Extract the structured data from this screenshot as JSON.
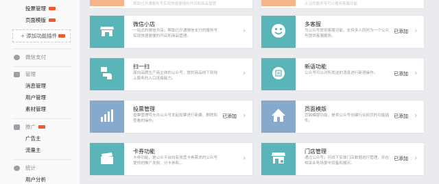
{
  "sidebar": {
    "top_items": [
      {
        "label": "投票管理",
        "badge": true
      },
      {
        "label": "页面模版",
        "badge": true
      }
    ],
    "add_plugin": {
      "icon": "plus-icon",
      "label": "添加功能插件",
      "badge": true
    },
    "groups": [
      {
        "icon": "wechat-pay-icon",
        "label": "微信支付",
        "items": []
      },
      {
        "icon": "manage-icon",
        "label": "管理",
        "items": [
          "消息管理",
          "用户管理",
          "素材管理"
        ]
      },
      {
        "icon": "promote-icon",
        "label": "推广",
        "badge": true,
        "items": [
          "广告主",
          "流量主"
        ]
      },
      {
        "icon": "stats-icon",
        "label": "统计",
        "items": [
          "用户分析"
        ]
      }
    ]
  },
  "cards": [
    {
      "name": "wechat-store",
      "title": "微信小店",
      "desc": "一站式的微信开店，帮助已开通微信支付的服务号实现快速便捷的开店和商品管理。",
      "status": "",
      "icon": "store-icon",
      "color": "#5ab5b8"
    },
    {
      "name": "customer-service",
      "title": "多客服",
      "desc": "为公众号提供客服功能，支持多人同时为一个公众号提供客服服务。",
      "status": "已添加",
      "icon": "smile-icon",
      "color": "#5ab5b8"
    },
    {
      "name": "scan",
      "title": "扫一扫",
      "desc": "面向品牌生产商主体的公众号，提供商品线下到线上服务的入口连接能力。",
      "status": "",
      "icon": "scan-hand-icon",
      "color": "#5ab5b8"
    },
    {
      "name": "new-reply",
      "title": "新语功能",
      "desc": "公众号可以对所发送的消息进行新语操作。",
      "status": "已添加",
      "icon": "reply-icon",
      "color": "#5ab5b8"
    },
    {
      "name": "vote-manage",
      "title": "投票管理",
      "desc": "投票管理可允许公众号发起投票进行新建、删除和查看的操作。",
      "status": "已添加",
      "icon": "bar-chart-icon",
      "color": "#86a9cc"
    },
    {
      "name": "page-template",
      "title": "页面模版",
      "desc": "页面模版功能，是将公众号创建行业网页的功能插件。",
      "status": "已添加",
      "icon": "home-icon",
      "color": "#86a9cc"
    },
    {
      "name": "card-coupon",
      "title": "卡券功能",
      "desc": "卡券功能，是公众平台向有效营卡券需求的公众号提供的推广发放、分卡券和...",
      "status": "",
      "icon": "card-icon",
      "color": "#5ab5b8"
    },
    {
      "name": "store-manage",
      "title": "门店管理",
      "desc": "通过公众号，可线下实体门店数据进行管理，并在相关业务场景中设备和展示。",
      "status": "已添加",
      "icon": "shop-icon",
      "color": "#5ab5b8"
    }
  ],
  "top_faint_text": [
    "帮助已开通服务号实现快速便捷的开店和商品管理",
    "认证的服务号可以使用客服功能"
  ]
}
